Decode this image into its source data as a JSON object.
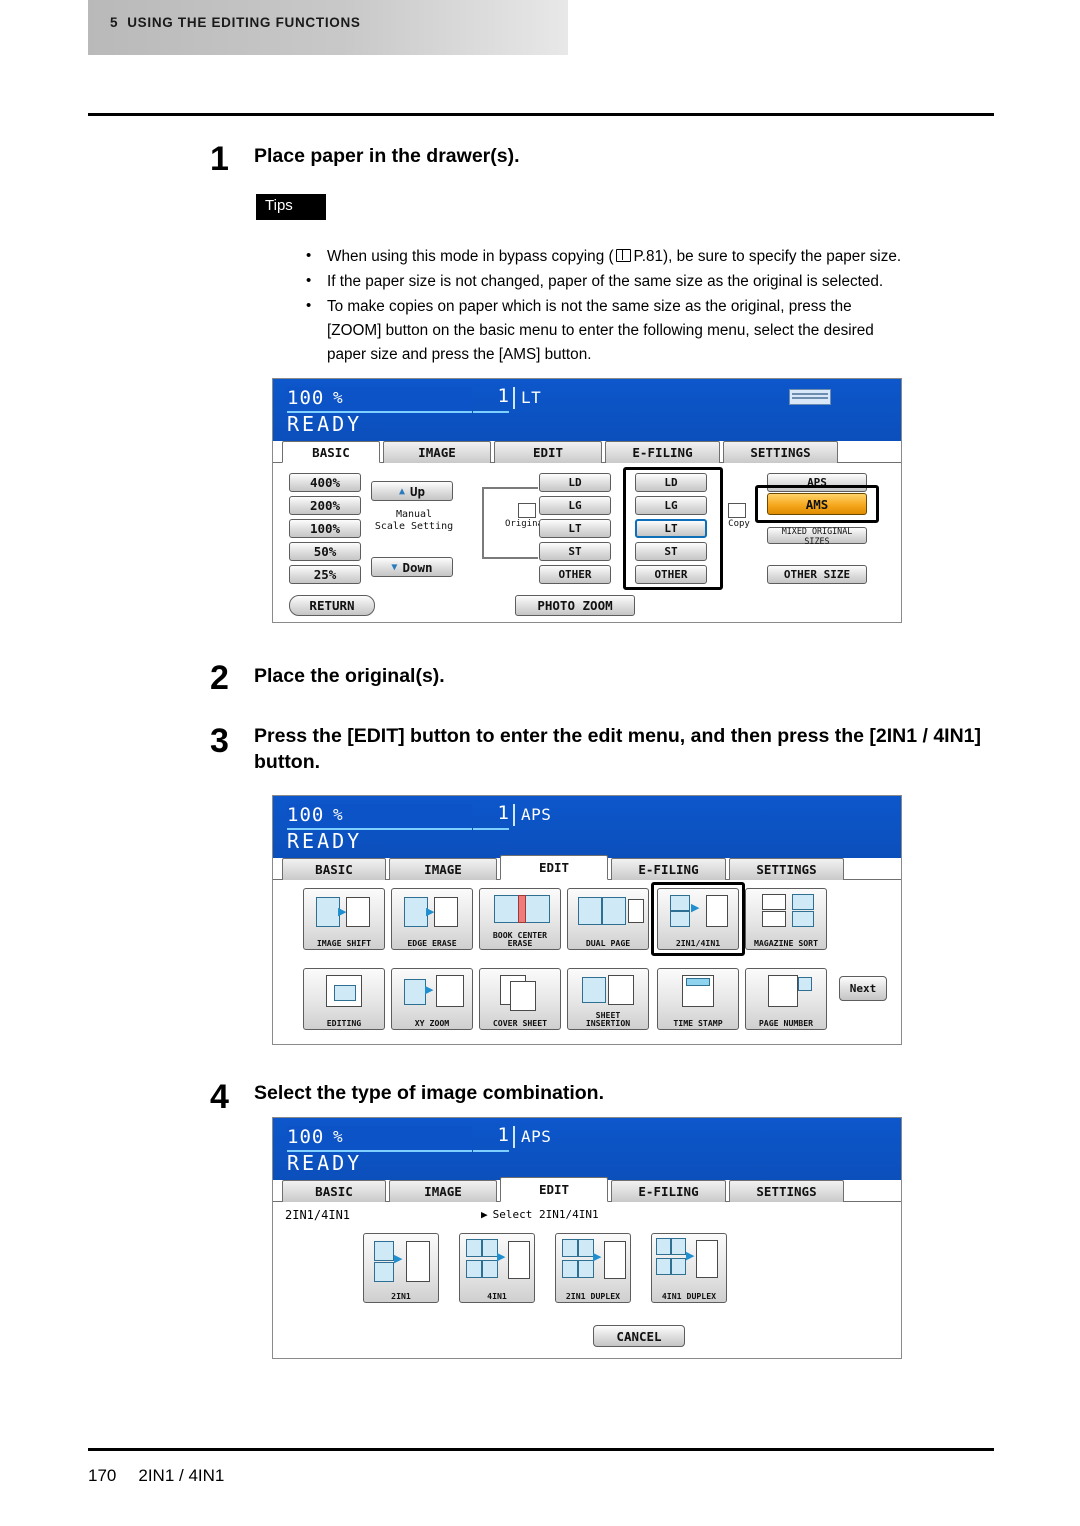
{
  "header": {
    "chapter": "5",
    "title": "USING THE EDITING FUNCTIONS"
  },
  "footer": {
    "page": "170",
    "title": "2IN1 / 4IN1"
  },
  "steps": [
    {
      "num": "1",
      "title": "Place paper in the drawer(s)."
    },
    {
      "num": "2",
      "title": "Place the original(s)."
    },
    {
      "num": "3",
      "title": "Press the [EDIT] button to enter the edit menu, and then press the [2IN1 / 4IN1] button."
    },
    {
      "num": "4",
      "title": "Select the type of image combination."
    }
  ],
  "tips": {
    "label": "Tips",
    "items": [
      "When using this mode in bypass copying (",
      "P.81), be sure to specify the paper size.",
      "If the paper size is not changed, paper of the same size as the original is selected.",
      "To make copies on paper which is not the same size as the original, press the [ZOOM] button on the basic menu to enter the following menu, select the desired paper size and press the [AMS] button."
    ],
    "item1_a": "When using this mode in bypass copying (",
    "item1_b": "P.81), be sure to specify the paper size.",
    "item2": "If the paper size is not changed, paper of the same size as the original is selected.",
    "item3_l1": "To make copies on paper which is not the same size as the original, press the",
    "item3_l2": "[ZOOM] button on the basic menu to enter the following menu, select the desired",
    "item3_l3": "paper size and press the [AMS] button."
  },
  "panel_zoom": {
    "status": {
      "zoom": "100",
      "percent": "%",
      "copies": "1",
      "paper": "LT",
      "ready": "READY"
    },
    "tabs": [
      {
        "label": "BASIC",
        "selected": true
      },
      {
        "label": "IMAGE",
        "selected": false
      },
      {
        "label": "EDIT",
        "selected": false
      },
      {
        "label": "E-FILING",
        "selected": false
      },
      {
        "label": "SETTINGS",
        "selected": false
      }
    ],
    "ratios": [
      "400%",
      "200%",
      "100%",
      "50%",
      "25%"
    ],
    "up": "Up",
    "down": "Down",
    "manual_l1": "Manual",
    "manual_l2": "Scale Setting",
    "original_label": "Original",
    "copy_label": "Copy",
    "original_sizes": [
      "LD",
      "LG",
      "LT",
      "ST",
      "OTHER"
    ],
    "copy_sizes": [
      "LD",
      "LG",
      "LT",
      "ST",
      "OTHER"
    ],
    "copy_selected": "LT",
    "right_buttons": [
      "APS",
      "AMS",
      "MIXED ORIGINAL SIZES",
      "OTHER SIZE"
    ],
    "ams_label": "AMS",
    "return_label": "RETURN",
    "photo_zoom_label": "PHOTO ZOOM"
  },
  "panel_edit": {
    "status": {
      "zoom": "100",
      "percent": "%",
      "copies": "1",
      "paper": "APS",
      "ready": "READY"
    },
    "tabs": [
      {
        "label": "BASIC",
        "selected": false
      },
      {
        "label": "IMAGE",
        "selected": false
      },
      {
        "label": "EDIT",
        "selected": true
      },
      {
        "label": "E-FILING",
        "selected": false
      },
      {
        "label": "SETTINGS",
        "selected": false
      }
    ],
    "row1": [
      {
        "label": "IMAGE SHIFT"
      },
      {
        "label": "EDGE ERASE"
      },
      {
        "label_l1": "BOOK CENTER",
        "label_l2": "ERASE"
      },
      {
        "label": "DUAL PAGE"
      },
      {
        "label": "2IN1/4IN1",
        "highlighted": true
      },
      {
        "label": "MAGAZINE SORT"
      }
    ],
    "row2": [
      {
        "label": "EDITING"
      },
      {
        "label": "XY ZOOM"
      },
      {
        "label": "COVER SHEET"
      },
      {
        "label_l1": "SHEET",
        "label_l2": "INSERTION"
      },
      {
        "label": "TIME STAMP"
      },
      {
        "label": "PAGE NUMBER"
      }
    ],
    "next_label": "Next"
  },
  "panel_2in1": {
    "status": {
      "zoom": "100",
      "percent": "%",
      "copies": "1",
      "paper": "APS",
      "ready": "READY"
    },
    "tabs": [
      {
        "label": "BASIC",
        "selected": false
      },
      {
        "label": "IMAGE",
        "selected": false
      },
      {
        "label": "EDIT",
        "selected": true
      },
      {
        "label": "E-FILING",
        "selected": false
      },
      {
        "label": "SETTINGS",
        "selected": false
      }
    ],
    "breadcrumb_mode": "2IN1/4IN1",
    "breadcrumb_sel": "Select 2IN1/4IN1",
    "options": [
      "2IN1",
      "4IN1",
      "2IN1 DUPLEX",
      "4IN1 DUPLEX"
    ],
    "cancel_label": "CANCEL"
  }
}
